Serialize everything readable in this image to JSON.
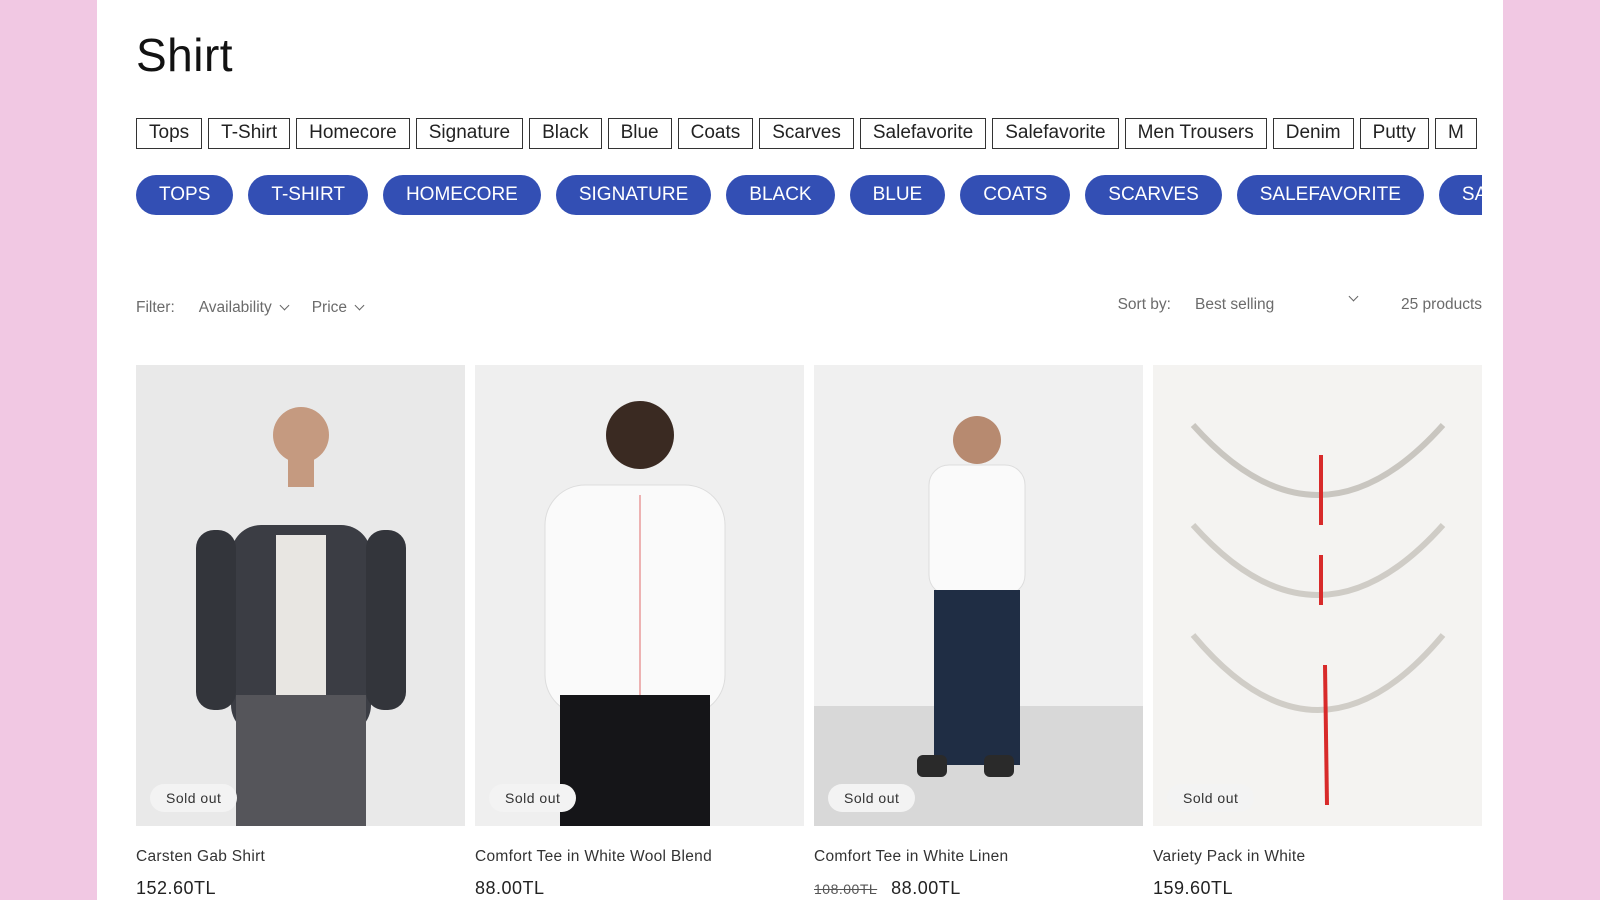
{
  "page_title": "Shirt",
  "tags": [
    "Tops",
    "T-Shirt",
    "Homecore",
    "Signature",
    "Black",
    "Blue",
    "Coats",
    "Scarves",
    "Salefavorite",
    "Salefavorite",
    "Men Trousers",
    "Denim",
    "Putty",
    "M"
  ],
  "pills": [
    "TOPS",
    "T-SHIRT",
    "HOMECORE",
    "SIGNATURE",
    "BLACK",
    "BLUE",
    "COATS",
    "SCARVES",
    "SALEFAVORITE",
    "SALEFAVORITE"
  ],
  "filter": {
    "label": "Filter:",
    "availability": "Availability",
    "price": "Price"
  },
  "sort": {
    "label": "Sort by:",
    "value": "Best selling",
    "count": "25 products"
  },
  "accent": "#334fb4",
  "products": [
    {
      "name": "Carsten Gab Shirt",
      "price": "152.60TL",
      "badge": "Sold out"
    },
    {
      "name": "Comfort Tee in White Wool Blend",
      "price": "88.00TL",
      "badge": "Sold out"
    },
    {
      "name": "Comfort Tee in White Linen",
      "old_price": "108.00TL",
      "price": "88.00TL",
      "badge": "Sold out"
    },
    {
      "name": "Variety Pack in White",
      "price": "159.60TL",
      "badge": "Sold out"
    }
  ]
}
